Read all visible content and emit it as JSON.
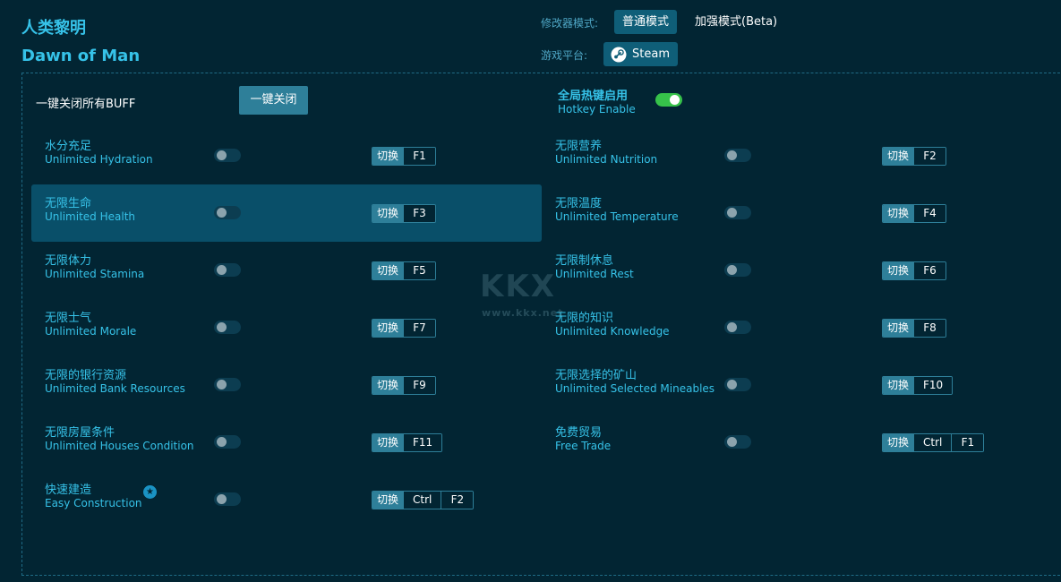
{
  "header": {
    "title_cn": "人类黎明",
    "title_en": "Dawn of Man",
    "mode_label": "修改器模式:",
    "mode_normal": "普通模式",
    "mode_beta": "加强模式(Beta)",
    "platform_label": "游戏平台:",
    "platform_name": "Steam"
  },
  "toolbar": {
    "buff_label": "一键关闭所有BUFF",
    "close_all_label": "一键关闭",
    "hotkey_title": "全局热键启用",
    "hotkey_sub": "Hotkey Enable",
    "hotkey_enabled": true
  },
  "swap_label": "切换",
  "cheats_left": [
    {
      "cn": "水分充足",
      "en": "Unlimited Hydration",
      "keys": [
        "F1"
      ],
      "enabled": false
    },
    {
      "cn": "无限生命",
      "en": "Unlimited Health",
      "keys": [
        "F3"
      ],
      "enabled": false
    },
    {
      "cn": "无限体力",
      "en": "Unlimited Stamina",
      "keys": [
        "F5"
      ],
      "enabled": false
    },
    {
      "cn": "无限士气",
      "en": "Unlimited Morale",
      "keys": [
        "F7"
      ],
      "enabled": false
    },
    {
      "cn": "无限的银行资源",
      "en": "Unlimited Bank Resources",
      "keys": [
        "F9"
      ],
      "enabled": false
    },
    {
      "cn": "无限房屋条件",
      "en": "Unlimited Houses Condition",
      "keys": [
        "F11"
      ],
      "enabled": false
    },
    {
      "cn": "快速建造",
      "en": "Easy Construction",
      "keys": [
        "Ctrl",
        "F2"
      ],
      "enabled": false,
      "star": true
    }
  ],
  "cheats_right": [
    {
      "cn": "无限营养",
      "en": "Unlimited Nutrition",
      "keys": [
        "F2"
      ],
      "enabled": false
    },
    {
      "cn": "无限温度",
      "en": "Unlimited Temperature",
      "keys": [
        "F4"
      ],
      "enabled": false
    },
    {
      "cn": "无限制休息",
      "en": "Unlimited Rest",
      "keys": [
        "F6"
      ],
      "enabled": false
    },
    {
      "cn": "无限的知识",
      "en": "Unlimited Knowledge",
      "keys": [
        "F8"
      ],
      "enabled": false
    },
    {
      "cn": "无限选择的矿山",
      "en": "Unlimited Selected Mineables",
      "keys": [
        "F10"
      ],
      "enabled": false
    },
    {
      "cn": "免费贸易",
      "en": "Free Trade",
      "keys": [
        "Ctrl",
        "F1"
      ],
      "enabled": false
    }
  ],
  "watermark": {
    "logo": "KKX",
    "url": "www.kkx.net"
  },
  "colors": {
    "accent": "#36c2e8",
    "background": "#022533",
    "highlight": "#094f69",
    "toggle_on": "#36c24a"
  }
}
